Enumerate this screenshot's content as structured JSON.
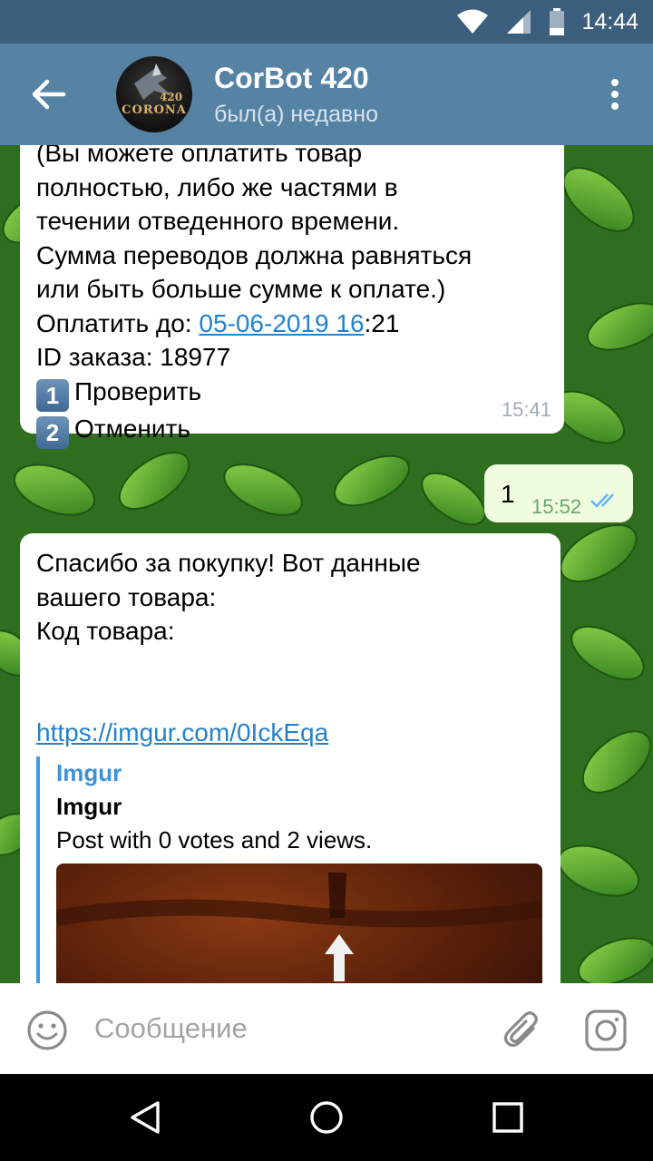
{
  "status_bar": {
    "time": "14:44"
  },
  "header": {
    "title": "CorBot 420",
    "status": "был(а) недавно",
    "avatar_text": "CORONA",
    "avatar_number": "420"
  },
  "messages": {
    "incoming_1": {
      "lines": [
        "(Вы можете оплатить товар",
        "полностью, либо же частями в",
        "течении отведенного времени.",
        "Сумма переводов должна равняться",
        "или быть больше сумме к оплате.)"
      ],
      "pay_until_label": "Оплатить до: ",
      "pay_until_link": "05-06-2019 16",
      "pay_until_rest": ":21",
      "order_id": "ID заказа: 18977",
      "option_1_key": "1",
      "option_1": "Проверить",
      "option_2_key": "2",
      "option_2": "Отменить",
      "time": "15:41"
    },
    "outgoing_1": {
      "text": "1",
      "time": "15:52"
    },
    "incoming_2": {
      "line_1": "Спасибо за покупку! Вот данные",
      "line_2": "вашего товара:",
      "line_3": "Код товара:",
      "link": "https://imgur.com/0IckEqa",
      "preview_site": "Imgur",
      "preview_title": "Imgur",
      "preview_desc": "Post with 0 votes and 2 views."
    }
  },
  "input_bar": {
    "placeholder": "Сообщение"
  },
  "colors": {
    "header": "#5682a3",
    "status_bar": "#3d5f7e",
    "link": "#2481cc",
    "outgoing_bubble": "#effdde",
    "chat_background": "#3f8f2a"
  }
}
